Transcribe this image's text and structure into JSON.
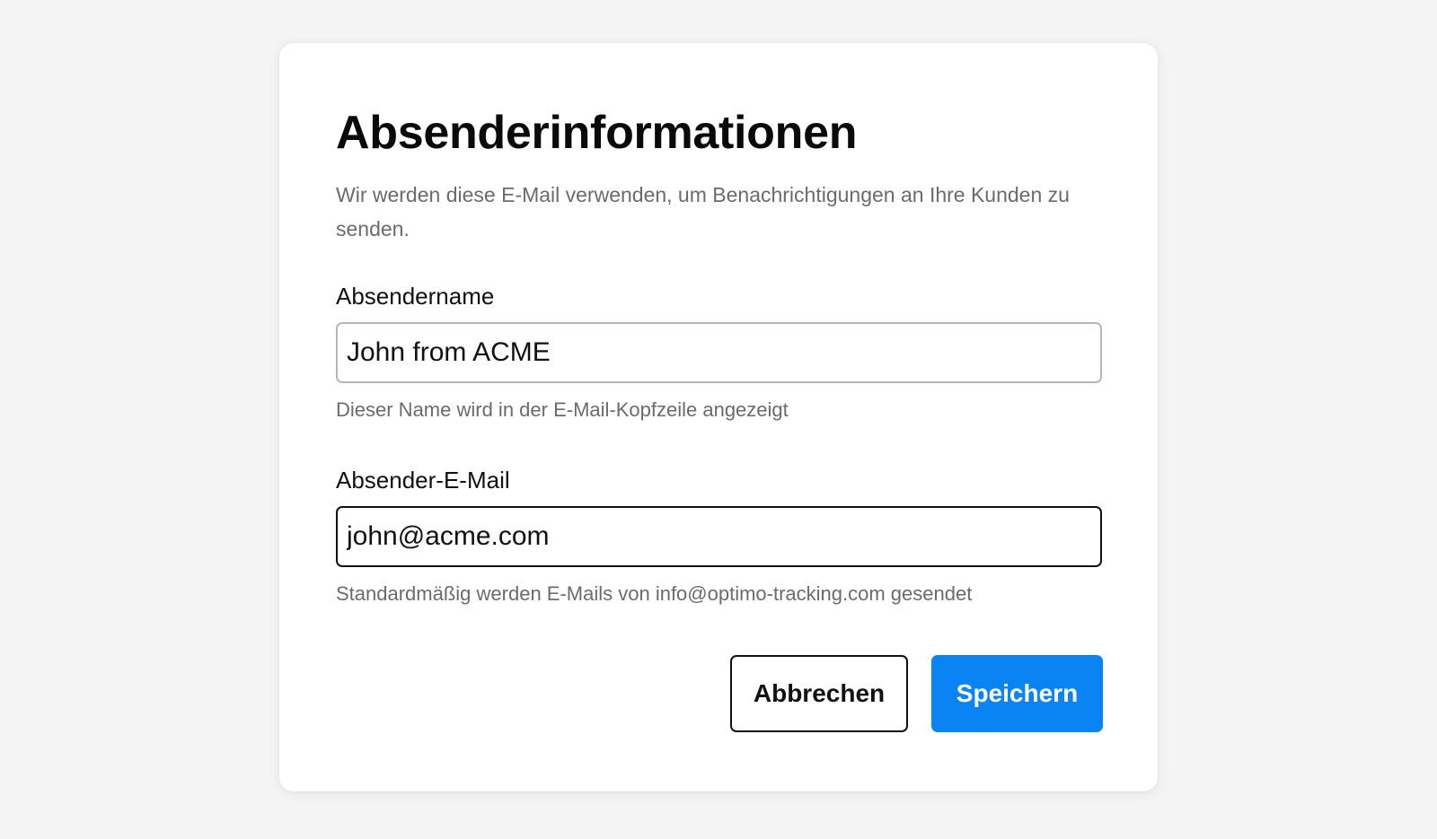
{
  "dialog": {
    "title": "Absenderinformationen",
    "subtitle": "Wir werden diese E-Mail verwenden, um Benachrichtigungen an Ihre Kunden zu senden."
  },
  "sender_name": {
    "label": "Absendername",
    "value": "John from ACME",
    "hint": "Dieser Name wird in der E-Mail-Kopfzeile angezeigt"
  },
  "sender_email": {
    "label": "Absender-E-Mail",
    "value": "john@acme.com",
    "hint": "Standardmäßig werden E-Mails von info@optimo-tracking.com gesendet"
  },
  "actions": {
    "cancel_label": "Abbrechen",
    "save_label": "Speichern"
  },
  "colors": {
    "primary": "#0a84f5",
    "background": "#f4f4f4",
    "muted_text": "#6b6b6b"
  }
}
